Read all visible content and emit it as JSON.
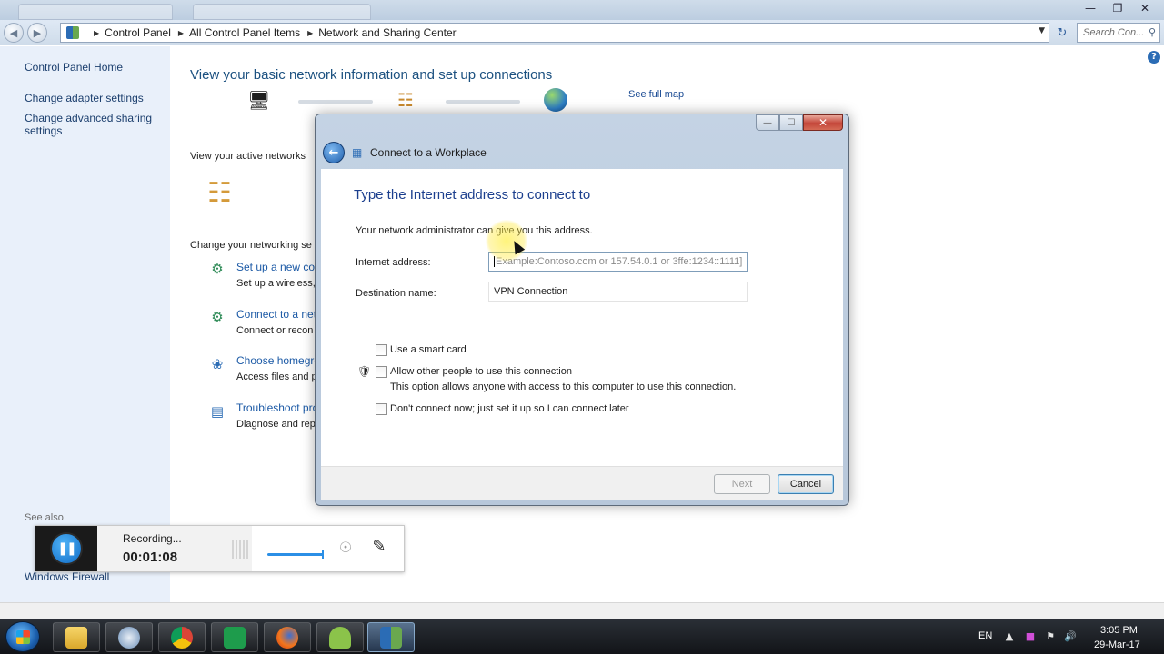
{
  "breadcrumb": {
    "items": [
      "Control Panel",
      "All Control Panel Items",
      "Network and Sharing Center"
    ]
  },
  "search": {
    "placeholder": "Search Con..."
  },
  "left_pane": {
    "home": "Control Panel Home",
    "adapter": "Change adapter settings",
    "advanced": "Change advanced sharing settings",
    "see_also": "See also",
    "firewall": "Windows Firewall"
  },
  "main": {
    "title": "View your basic network information and set up connections",
    "see_full_map": "See full map",
    "active_networks": "View your active networks",
    "change_settings": "Change your networking se",
    "tasks": [
      {
        "link": "Set up a new conn",
        "desc": "Set up a wireless, b"
      },
      {
        "link": "Connect to a netw",
        "desc": "Connect or recon"
      },
      {
        "link": "Choose homegro",
        "desc": "Access files and p"
      },
      {
        "link": "Troubleshoot pro",
        "desc": "Diagnose and rep"
      }
    ]
  },
  "dialog": {
    "title": "Connect to a Workplace",
    "heading": "Type the Internet address to connect to",
    "hint": "Your network administrator can give you this address.",
    "internet_address_label": "Internet address:",
    "internet_address_placeholder": "Example:Contoso.com or 157.54.0.1 or 3ffe:1234::1111]",
    "destination_label": "Destination name:",
    "destination_value": "VPN Connection",
    "smart_card": "Use a smart card",
    "allow_others": "Allow other people to use this connection",
    "allow_others_desc": "This option allows anyone with access to this computer to use this connection.",
    "dont_connect": "Don't connect now; just set it up so I can connect later",
    "next": "Next",
    "cancel": "Cancel"
  },
  "recorder": {
    "status": "Recording...",
    "time": "00:01:08"
  },
  "taskbar": {
    "language": "EN",
    "time": "3:05 PM",
    "date": "29-Mar-17"
  },
  "colors": {
    "link": "#1c5aa6",
    "heading": "#1c3f8e",
    "left_pane_bg": "#e9f0fa",
    "taskbar_bg": "#121418"
  }
}
